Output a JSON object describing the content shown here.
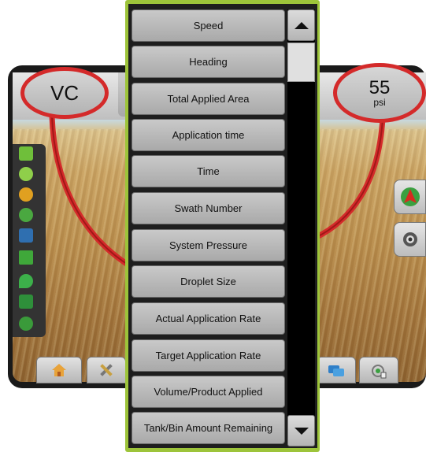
{
  "header": {
    "left_readout": "VC",
    "right_readout_value": "55",
    "right_readout_unit": "psi"
  },
  "menu": {
    "items": [
      {
        "label": "Speed"
      },
      {
        "label": "Heading"
      },
      {
        "label": "Total Applied Area"
      },
      {
        "label": "Application time"
      },
      {
        "label": "Time"
      },
      {
        "label": "Swath Number"
      },
      {
        "label": "System Pressure"
      },
      {
        "label": "Droplet Size"
      },
      {
        "label": "Actual Application Rate"
      },
      {
        "label": "Target Application Rate"
      },
      {
        "label": "Volume/Product Applied"
      },
      {
        "label": "Tank/Bin Amount Remaining"
      }
    ],
    "border_color": "#9dc43a"
  },
  "colors": {
    "callout": "#d42a2a",
    "accent_green": "#9dc43a"
  },
  "icons": {
    "left_column": [
      "boom-status-icon",
      "row-icon",
      "target-icon",
      "section-icon",
      "bin-icon",
      "guidance-icon",
      "droplet-icon",
      "sprayer-icon",
      "link-icon"
    ],
    "right_column": [
      "navigation-arrow-icon",
      "camera-icon"
    ],
    "bottom_tabs": [
      "home-icon",
      "tools-icon",
      "data-icon",
      "gps-icon"
    ]
  }
}
